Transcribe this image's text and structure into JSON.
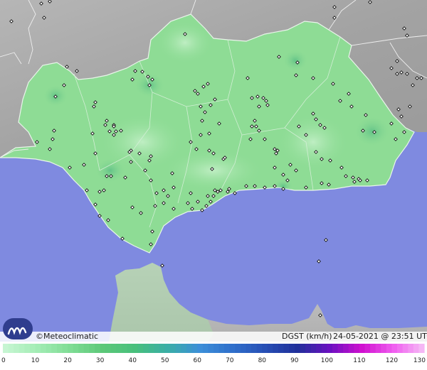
{
  "brand": {
    "name": "©Meteoclimatic"
  },
  "caption": {
    "variable": "DGST (km/h)",
    "datetime": "24-05-2021 @ 23:51 UTC"
  },
  "legend": {
    "labels": [
      "0",
      "10",
      "20",
      "30",
      "40",
      "50",
      "60",
      "70",
      "80",
      "90",
      "100",
      "110",
      "120",
      "130"
    ],
    "colors": [
      "#c6f5d2",
      "#a2ecb4",
      "#7fdc95",
      "#5cc878",
      "#48c07c",
      "#3aaea6",
      "#3c8fd8",
      "#2f6fcb",
      "#274fb5",
      "#1f2f9a",
      "#6a10c0",
      "#d010d0",
      "#f060f0",
      "#f6c8f6"
    ]
  },
  "colors": {
    "sea": "#7f8ae0",
    "land_outside": "#a9a9a9",
    "region": "#8edc95"
  },
  "stations": {
    "count_approx": 180
  }
}
